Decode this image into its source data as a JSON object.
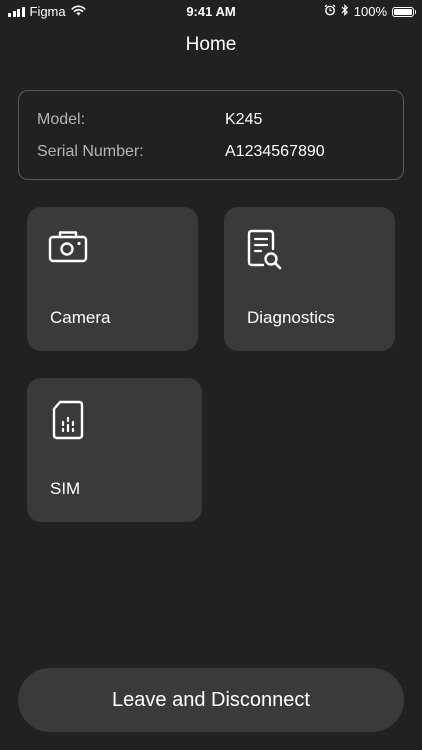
{
  "status_bar": {
    "carrier": "Figma",
    "time": "9:41 AM",
    "battery": "100%",
    "battery_level": 1.0,
    "icons": [
      "signal-icon",
      "wifi-icon",
      "alarm-icon",
      "bluetooth-icon",
      "battery-icon"
    ]
  },
  "header": {
    "title": "Home"
  },
  "device_info": {
    "model_label": "Model:",
    "model_value": "K245",
    "serial_label": "Serial Number:",
    "serial_value": "A1234567890"
  },
  "tiles": [
    {
      "label": "Camera",
      "icon": "camera-icon"
    },
    {
      "label": "Diagnostics",
      "icon": "diagnostics-icon"
    },
    {
      "label": "SIM",
      "icon": "sim-card-icon"
    }
  ],
  "footer": {
    "leave_label": "Leave and Disconnect"
  },
  "colors": {
    "background": "#212121",
    "tile": "#3a3a3a",
    "card_border": "#5a5a5a",
    "label_text": "#b5b5b5",
    "text": "#ffffff"
  }
}
